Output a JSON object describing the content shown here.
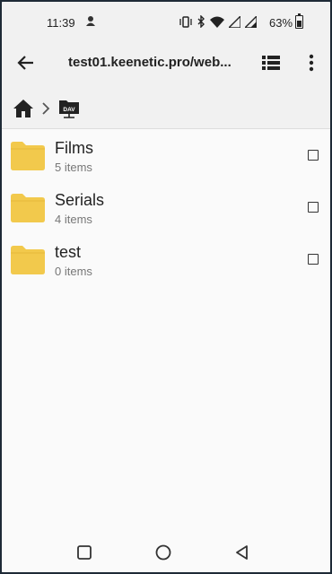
{
  "status": {
    "time": "11:39",
    "battery": "63%"
  },
  "appbar": {
    "title": "test01.keenetic.pro/web..."
  },
  "breadcrumb": {
    "dav_label": "DAV"
  },
  "items": [
    {
      "name": "Films",
      "count": "5 items"
    },
    {
      "name": "Serials",
      "count": "4 items"
    },
    {
      "name": "test",
      "count": "0 items"
    }
  ],
  "colors": {
    "folder": "#f2c94c",
    "folder_tab": "#e6b93a",
    "bar_bg": "#f1f1f1",
    "page_bg": "#fafafa"
  }
}
